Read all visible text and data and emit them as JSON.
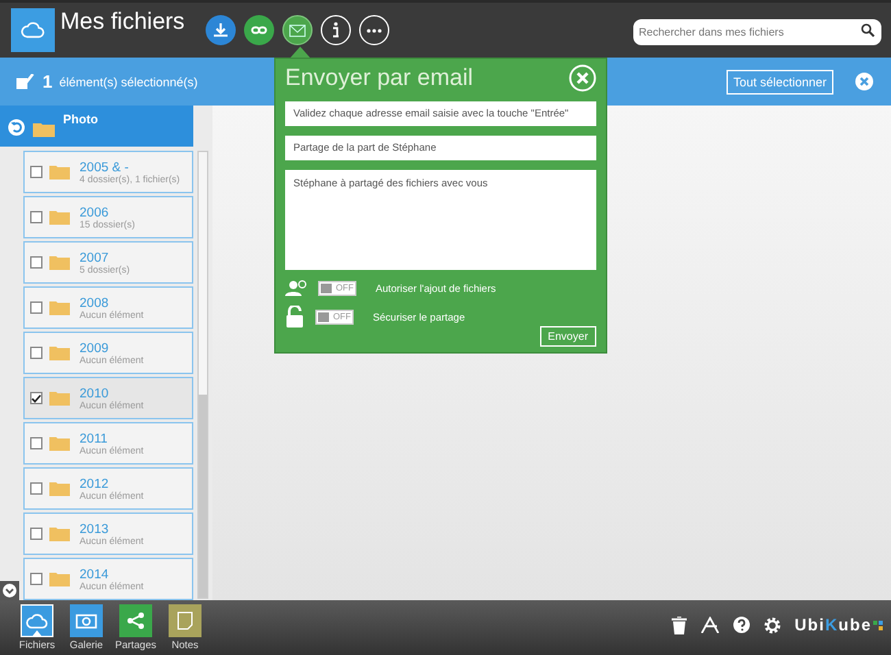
{
  "header": {
    "title": "Mes fichiers",
    "search": {
      "placeholder": "Rechercher dans mes fichiers"
    }
  },
  "selection_bar": {
    "count": "1",
    "label": "élément(s) sélectionné(s)",
    "select_all": "Tout sélectionner"
  },
  "folder": {
    "name": "Photo"
  },
  "items": [
    {
      "name": "2005 & -",
      "info": "4 dossier(s), 1 fichier(s)",
      "checked": false
    },
    {
      "name": "2006",
      "info": "15 dossier(s)",
      "checked": false
    },
    {
      "name": "2007",
      "info": "5 dossier(s)",
      "checked": false
    },
    {
      "name": "2008",
      "info": "Aucun élément",
      "checked": false
    },
    {
      "name": "2009",
      "info": "Aucun élément",
      "checked": false
    },
    {
      "name": "2010",
      "info": "Aucun élément",
      "checked": true
    },
    {
      "name": "2011",
      "info": "Aucun élément",
      "checked": false
    },
    {
      "name": "2012",
      "info": "Aucun élément",
      "checked": false
    },
    {
      "name": "2013",
      "info": "Aucun élément",
      "checked": false
    },
    {
      "name": "2014",
      "info": "Aucun élément",
      "checked": false
    }
  ],
  "email_popup": {
    "title": "Envoyer par email",
    "recipients": {
      "placeholder": "Validez chaque adresse email saisie avec la touche \"Entrée\""
    },
    "subject": {
      "value": "Partage de la part de Stéphane"
    },
    "message": {
      "value": "Stéphane à partagé des fichiers avec vous"
    },
    "options": [
      {
        "kind": "upload",
        "label": "Autoriser l'ajout de fichiers",
        "state": "OFF",
        "on": false
      },
      {
        "kind": "lock",
        "label": "Sécuriser le partage",
        "state": "OFF",
        "on": false
      }
    ],
    "send": "Envoyer"
  },
  "bottom_tabs": [
    {
      "kind": "cloud",
      "label": "Fichiers",
      "selected": true
    },
    {
      "kind": "camera",
      "label": "Galerie",
      "selected": false
    },
    {
      "kind": "share",
      "label": "Partages",
      "selected": false
    },
    {
      "kind": "notes",
      "label": "Notes",
      "selected": false
    }
  ],
  "logo": {
    "parts": [
      "Ubi",
      "K",
      "ube"
    ]
  }
}
